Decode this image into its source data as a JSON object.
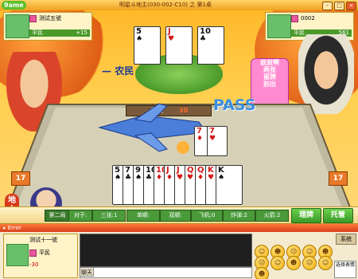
{
  "window": {
    "logo": "9ame",
    "title": "明星斗地主(030-002-C10) 之 第1桌",
    "buttons": [
      "-",
      "□",
      "×"
    ]
  },
  "players": {
    "left": {
      "name": "测试五號",
      "role": "平民",
      "score": "+15"
    },
    "right": {
      "name": "0002",
      "role": "平民",
      "score": "561"
    },
    "bottom": {
      "name": "测试十一號",
      "role": "平民",
      "score": "-30"
    }
  },
  "top_cards": [
    {
      "rank": "5",
      "suit": "♠",
      "color": "blk"
    },
    {
      "rank": "J",
      "suit": "♥",
      "color": "red"
    },
    {
      "rank": "10",
      "suit": "♣",
      "color": "blk"
    }
  ],
  "labels": {
    "nongmin": "农民",
    "pass": "PASS",
    "multiplier_label": "倍数",
    "multiplier_value": "30",
    "bubble": [
      "叔叔啊",
      "两张",
      "留牌",
      "别出"
    ],
    "left_count": "17",
    "right_count": "17",
    "dizhu": "地主",
    "round": "第二局"
  },
  "played_cards": [
    {
      "rank": "7",
      "suit": "♦",
      "color": "red"
    },
    {
      "rank": "7",
      "suit": "♥",
      "color": "red"
    }
  ],
  "hand_cards": [
    {
      "rank": "5",
      "suit": "♠",
      "color": "blk"
    },
    {
      "rank": "7",
      "suit": "♣",
      "color": "blk"
    },
    {
      "rank": "9",
      "suit": "♠",
      "color": "blk"
    },
    {
      "rank": "10",
      "suit": "♣",
      "color": "blk"
    },
    {
      "rank": "10",
      "suit": "♦",
      "color": "red"
    },
    {
      "rank": "J",
      "suit": "♦",
      "color": "red"
    },
    {
      "rank": "J",
      "suit": "♥",
      "color": "red"
    },
    {
      "rank": "Q",
      "suit": "♥",
      "color": "red"
    },
    {
      "rank": "Q",
      "suit": "♦",
      "color": "red"
    },
    {
      "rank": "K",
      "suit": "♥",
      "color": "red"
    },
    {
      "rank": "K",
      "suit": "♠",
      "color": "blk"
    }
  ],
  "hints": [
    "对子:",
    "三张:1",
    "单顺:",
    "双顺:",
    "飞机:0",
    "炸弹:2",
    "火箭:2"
  ],
  "buttons": {
    "sort": "理牌",
    "hosting": "托管"
  },
  "bottom": {
    "error_label": "Error",
    "chat_button": "聊天",
    "system_button": "系统",
    "emoji_labels": [
      "选择表情"
    ]
  }
}
